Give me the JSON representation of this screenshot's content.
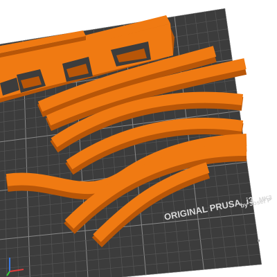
{
  "viewport": {
    "background": "#ffffff"
  },
  "bed": {
    "name_line1": "ORIGINAL PRUSA",
    "model": "i3",
    "model_suffix": "MK3",
    "author_line": "by Josef P",
    "colors": {
      "surface": "#3c3c3c",
      "grid_minor": "#565656",
      "grid_major": "#8a8a8a",
      "text": "#d9d9d9"
    }
  },
  "objects": {
    "filament_color": "#f07a12",
    "shade_color": "#b85608",
    "highlight_color": "#ff9a3a",
    "items": [
      {
        "name": "bridge-truss-part"
      },
      {
        "name": "curved-rail-part-1"
      },
      {
        "name": "curved-rail-part-2"
      },
      {
        "name": "curved-rail-part-3"
      },
      {
        "name": "curved-rail-part-4"
      },
      {
        "name": "curved-rail-part-5"
      },
      {
        "name": "curved-rail-part-6"
      }
    ]
  },
  "axis_gizmo": {
    "x_color": "#e23b3b",
    "y_color": "#3bd13b",
    "z_color": "#3b7be2"
  }
}
